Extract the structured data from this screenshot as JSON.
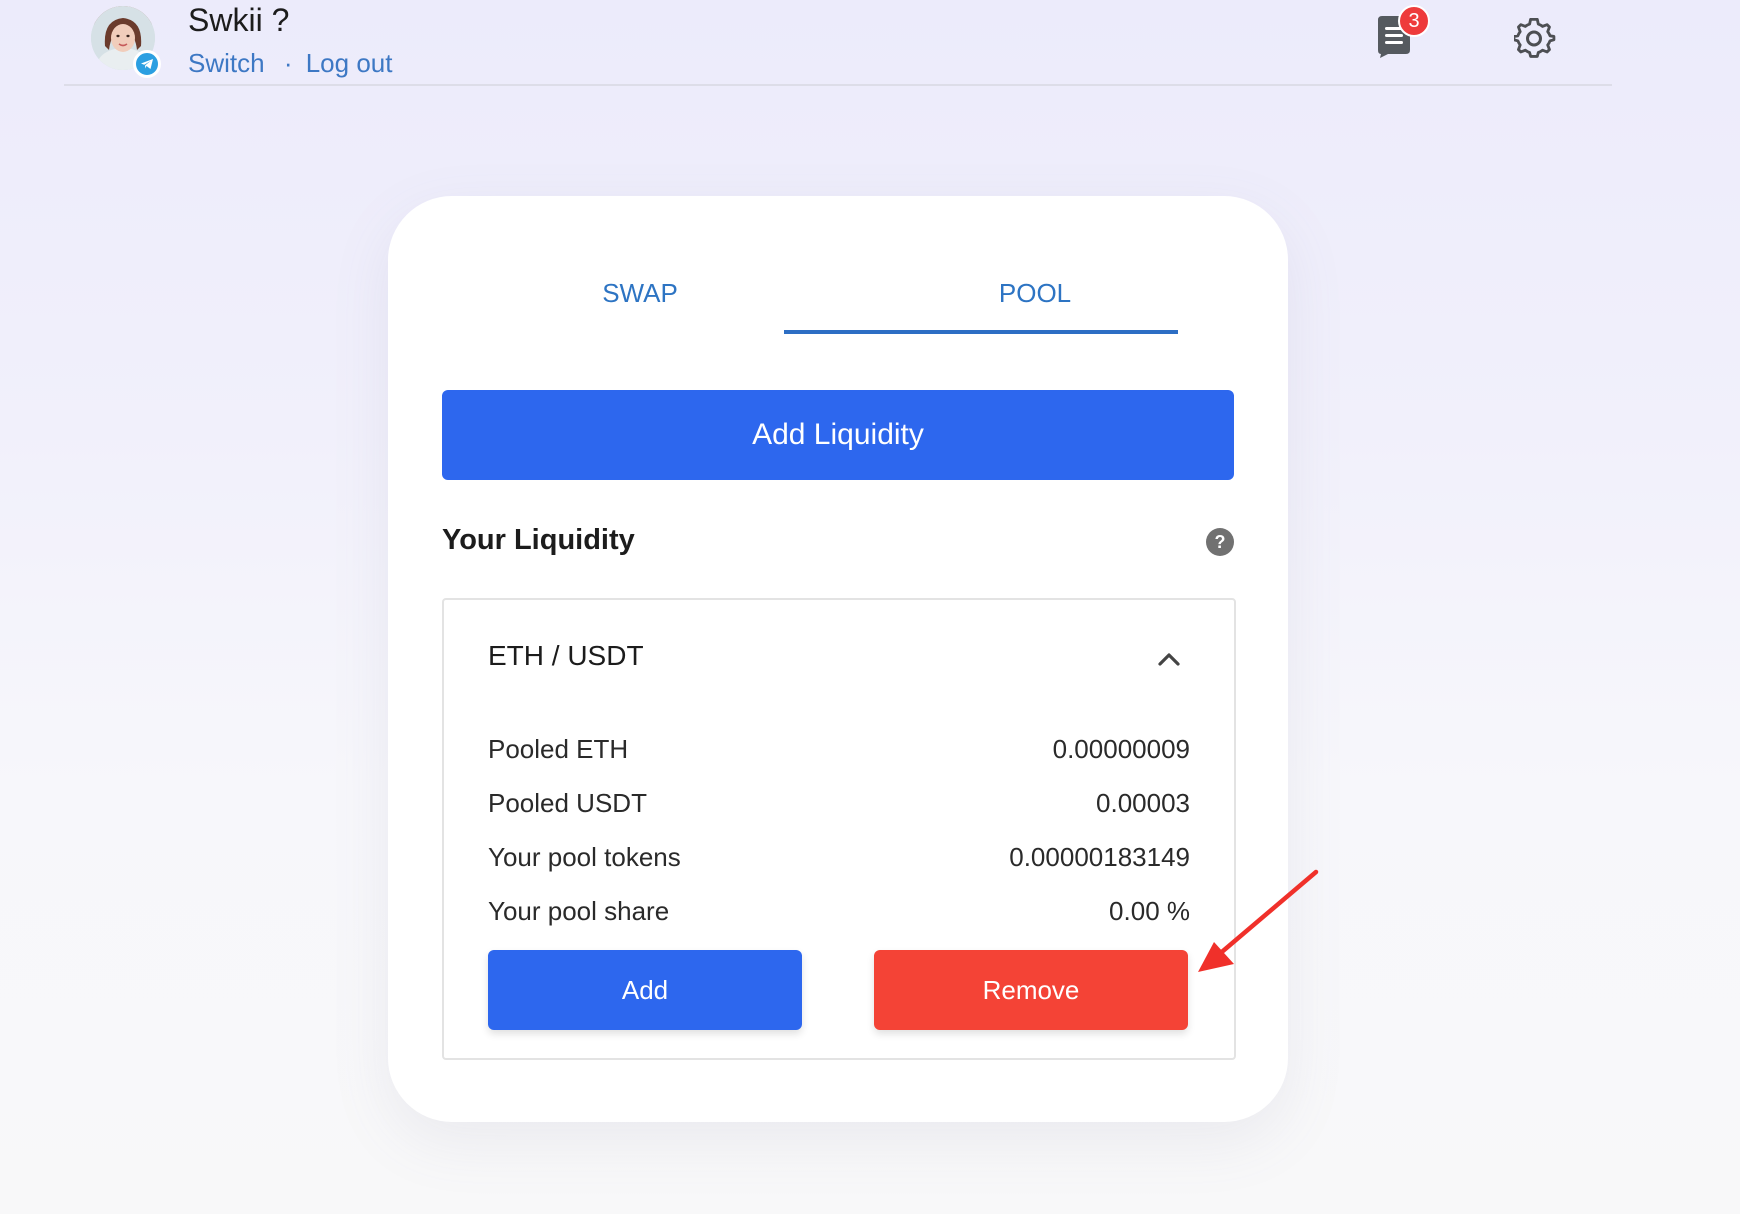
{
  "header": {
    "username": "Swkii ?",
    "switch_label": "Switch",
    "separator": "·",
    "logout_label": "Log out",
    "notification_count": "3",
    "icons": [
      "avatar",
      "telegram-icon",
      "notification-icon",
      "gear-icon"
    ]
  },
  "tabs": [
    {
      "label": "SWAP",
      "active": false
    },
    {
      "label": "POOL",
      "active": true
    }
  ],
  "add_liquidity_label": "Add Liquidity",
  "your_liquidity": {
    "title": "Your Liquidity",
    "help_symbol": "?"
  },
  "pool": {
    "pair": "ETH / USDT",
    "expanded": true,
    "stats": [
      {
        "label": "Pooled ETH",
        "value": "0.00000009"
      },
      {
        "label": "Pooled USDT",
        "value": "0.00003"
      },
      {
        "label": "Your pool tokens",
        "value": "0.00000183149"
      },
      {
        "label": "Your pool share",
        "value": "0.00 %"
      }
    ],
    "add_label": "Add",
    "remove_label": "Remove"
  },
  "colors": {
    "primary_blue": "#2d67ee",
    "link_blue": "#3d78c4",
    "remove_red": "#f44336",
    "badge_red": "#ee3b3b",
    "annotation_arrow": "#f0302a"
  }
}
